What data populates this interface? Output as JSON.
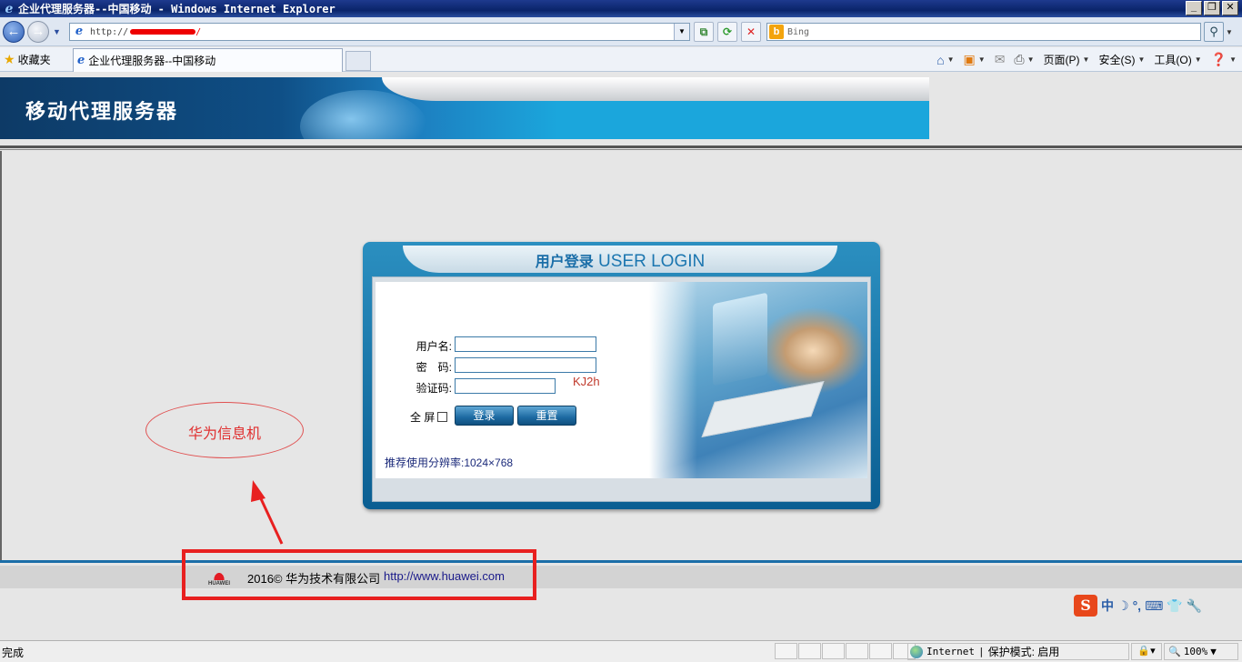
{
  "window": {
    "title": "企业代理服务器--中国移动 - Windows Internet Explorer",
    "controls": {
      "minimize": "_",
      "restore": "❐",
      "close": "✕"
    }
  },
  "address_bar": {
    "url_prefix": "http://",
    "url_tail": "/",
    "search_placeholder": "Bing"
  },
  "favorites": {
    "label": "收藏夹"
  },
  "tab": {
    "title": "企业代理服务器--中国移动"
  },
  "command_bar": {
    "page": "页面(P)",
    "safety": "安全(S)",
    "tools": "工具(O)"
  },
  "banner": {
    "title": "移动代理服务器"
  },
  "login": {
    "heading_cn": "用户登录",
    "heading_en": "USER LOGIN",
    "username_label": "用户名:",
    "password_label": "密　码:",
    "captcha_label": "验证码:",
    "username_value": "",
    "password_value": "",
    "captcha_value": "",
    "captcha_code": "KJ2h",
    "fullscreen_label": "全 屏",
    "login_button": "登录",
    "reset_button": "重置",
    "resolution_note": "推荐使用分辨率:1024×768"
  },
  "annotation": {
    "label": "华为信息机"
  },
  "footer": {
    "logo_text": "HUAWEI",
    "copyright": "2016© 华为技术有限公司",
    "link": "http://www.huawei.com"
  },
  "ime": {
    "mode": "中",
    "moon": "☽",
    "punct": "°,",
    "keyboard": "⌨",
    "shirt": "👕",
    "wrench": "🔧"
  },
  "status_bar": {
    "text": "完成",
    "zone": "Internet",
    "protected_mode": "保护模式: 启用",
    "zoom": "100%"
  }
}
